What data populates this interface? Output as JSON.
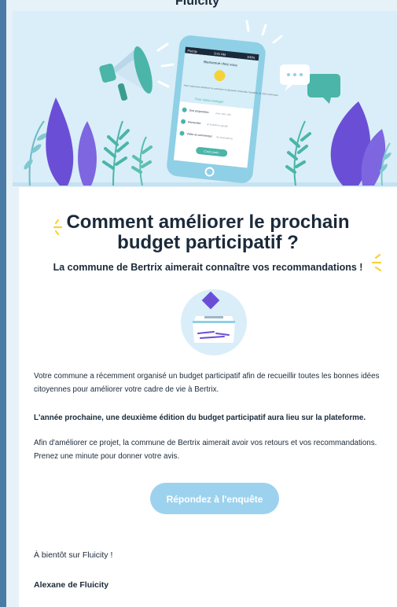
{
  "brand": {
    "name": "Fluicity"
  },
  "hero": {
    "phone": {
      "status_left": "Fluicity",
      "status_mid": "9:41 AM",
      "status_right": "100%",
      "screen_title": "Bienvenue chez vous",
      "screen_body": "Avec vous pour améliorer la commune et découvrir ensemble l'actualité de votre commune.",
      "section_title": "Pour mieux partager",
      "items": [
        {
          "title": "Une proposition",
          "desc": "pour votre ville"
        },
        {
          "title": "Remontez",
          "desc": "un problème signalé"
        },
        {
          "title": "Votez et commentez",
          "desc": "les propositions"
        }
      ],
      "button": "C'est parti !"
    }
  },
  "email": {
    "title_line1": "Comment améliorer le prochain",
    "title_line2": "budget participatif ?",
    "subtitle": "La commune de Bertrix aimerait connaître vos recommandations !",
    "para1": "Votre commune a récemment organisé un budget participatif afin de recueillir toutes les bonnes idées citoyennes pour améliorer votre cadre de vie à Bertrix.",
    "para2": "L'année prochaine, une deuxième édition du budget participatif aura lieu sur la plateforme.",
    "para3": "Afin d'améliorer ce projet, la commune de Bertrix aimerait avoir vos retours et vos recommandations. Prenez une minute pour donner votre avis.",
    "cta_label": "Répondez à l'enquête",
    "signoff": "À bientôt sur Fluicity !",
    "signature": "Alexane de Fluicity"
  },
  "colors": {
    "accent": "#9dd2ee",
    "hero_bg": "#d9eef8",
    "teal": "#4ab5a8",
    "purple": "#6a4fd6",
    "sparkle": "#f6d23a"
  }
}
